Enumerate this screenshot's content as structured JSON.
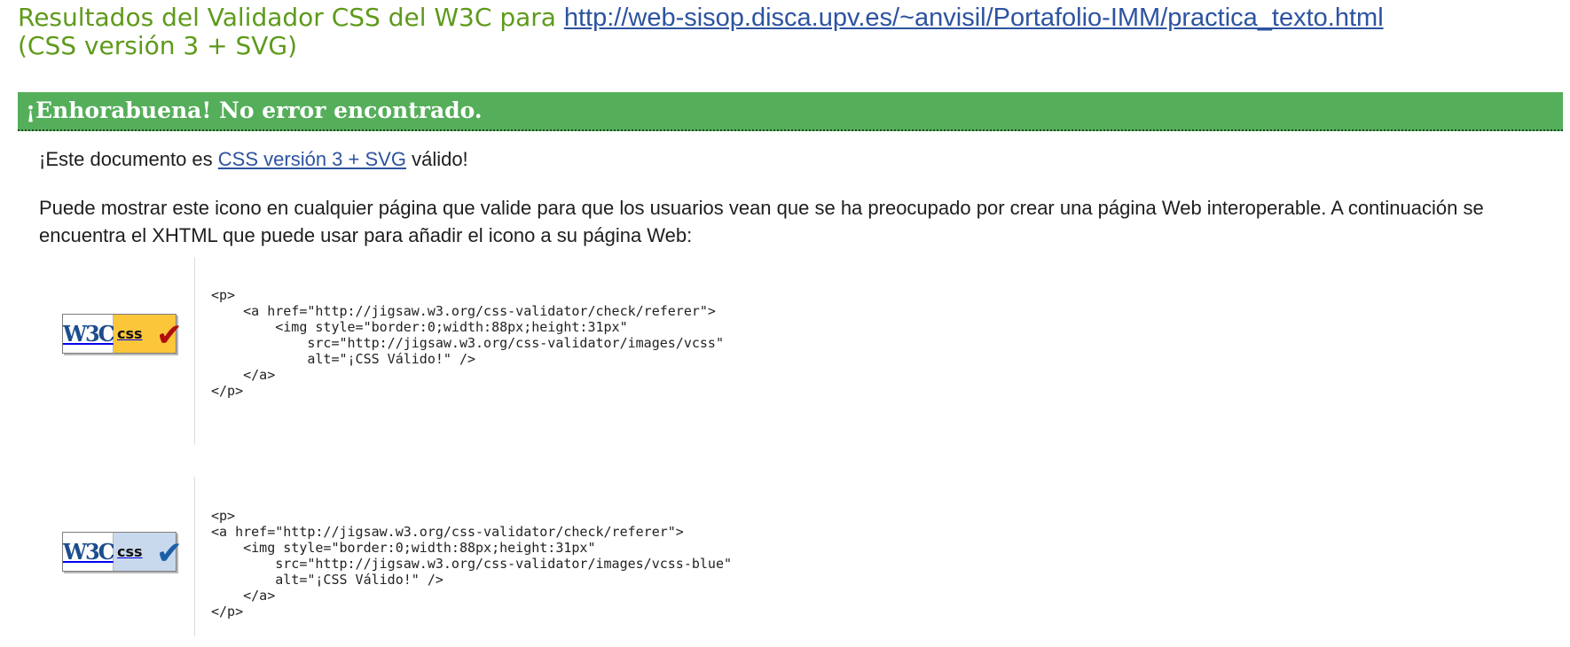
{
  "header": {
    "title_prefix": "Resultados del Validador CSS del W3C para",
    "url": "http://web-sisop.disca.upv.es/~anvisil/Portafolio-IMM/practica_texto.html",
    "profile": "(CSS versión 3 + SVG)"
  },
  "banner": {
    "text": "¡Enhorabuena! No error encontrado."
  },
  "valid_message": {
    "prefix": "¡Este documento es",
    "link": "CSS versión 3 + SVG",
    "suffix": "válido!"
  },
  "icon_intro": "Puede mostrar este icono en cualquier página que valide para que los usuarios vean que se ha preocupado por crear una página Web interoperable. A continuación se encuentra el XHTML que puede usar para añadir el icono a su página Web:",
  "badges": [
    {
      "icon": "w3c-css-valid-gold-badge-icon",
      "w3c_text": "W3C",
      "css_text": "css",
      "check": "✔",
      "color": "#fcc63b",
      "code": "<p>\n    <a href=\"http://jigsaw.w3.org/css-validator/check/referer\">\n        <img style=\"border:0;width:88px;height:31px\"\n            src=\"http://jigsaw.w3.org/css-validator/images/vcss\"\n            alt=\"¡CSS Válido!\" />\n    </a>\n</p>"
    },
    {
      "icon": "w3c-css-valid-blue-badge-icon",
      "w3c_text": "W3C",
      "css_text": "css",
      "check": "✔",
      "color": "#c8d9ee",
      "code": "<p>\n<a href=\"http://jigsaw.w3.org/css-validator/check/referer\">\n    <img style=\"border:0;width:88px;height:31px\"\n        src=\"http://jigsaw.w3.org/css-validator/images/vcss-blue\"\n        alt=\"¡CSS Válido!\" />\n    </a>\n</p>"
    }
  ],
  "colors": {
    "title_green": "#5e9a1a",
    "link_blue": "#2c53a0",
    "banner_green": "#55ae5a"
  }
}
